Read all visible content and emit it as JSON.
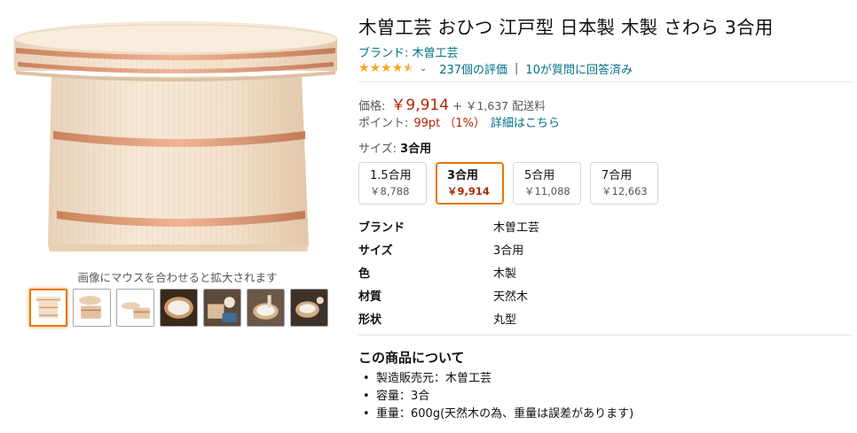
{
  "product": {
    "title": "木曽工芸 おひつ 江戸型 日本製 木製 さわら 3合用",
    "brand_link": "ブランド: 木曽工芸",
    "rating": {
      "stars": 4.5,
      "count_text": "237個の評価",
      "qa_text": "10が質問に回答済み"
    },
    "price": {
      "label": "価格:",
      "value": "￥9,914",
      "plus": "+",
      "shipping": "￥1,637 配送料"
    },
    "points": {
      "label": "ポイント:",
      "value": "99pt （1%）",
      "link": "詳細はこちら"
    },
    "size": {
      "label": "サイズ:",
      "selected": "3合用"
    },
    "swatches": [
      {
        "name": "1.5合用",
        "price": "￥8,788"
      },
      {
        "name": "3合用",
        "price": "￥9,914"
      },
      {
        "name": "5合用",
        "price": "￥11,088"
      },
      {
        "name": "7合用",
        "price": "￥12,663"
      }
    ],
    "specs": [
      {
        "key": "ブランド",
        "value": "木曽工芸"
      },
      {
        "key": "サイズ",
        "value": "3合用"
      },
      {
        "key": "色",
        "value": "木製"
      },
      {
        "key": "材質",
        "value": "天然木"
      },
      {
        "key": "形状",
        "value": "丸型"
      }
    ],
    "about_title": "この商品について",
    "bullets": [
      "製造販売元：木曽工芸",
      "容量：3合",
      "重量：600g(天然木の為、重量は誤差があります)"
    ]
  },
  "gallery": {
    "hover_hint": "画像にマウスを合わせると拡大されます",
    "thumbnail_count": 7,
    "active_index": 0
  },
  "colors": {
    "link": "#007185",
    "price": "#b12704",
    "star": "#ffa41c",
    "selected_border": "#e77600"
  }
}
